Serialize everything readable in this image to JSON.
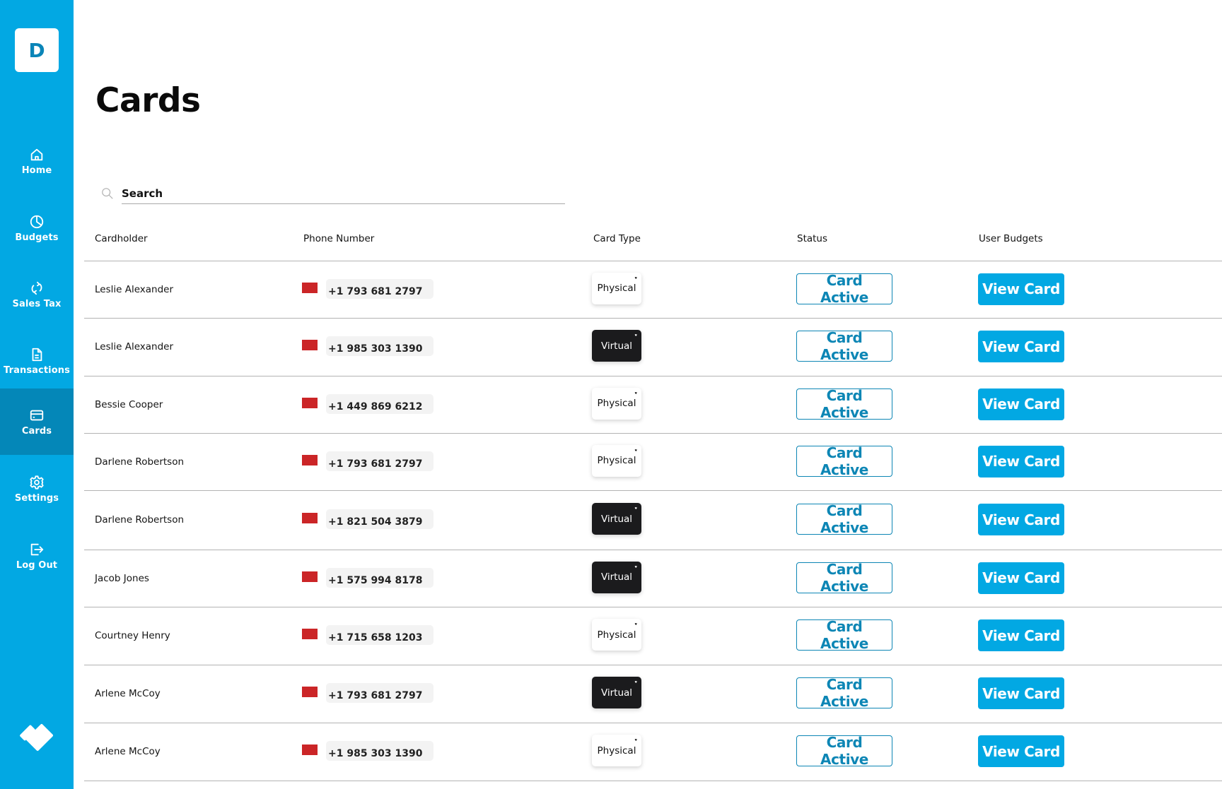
{
  "app": {
    "logo_letter": "D",
    "page_title": "Cards"
  },
  "sidebar": {
    "items": [
      {
        "label": "Home",
        "icon": "home-icon",
        "active": false
      },
      {
        "label": "Budgets",
        "icon": "pie-chart-icon",
        "active": false
      },
      {
        "label": "Sales Tax",
        "icon": "refresh-icon",
        "active": false
      },
      {
        "label": "Transactions",
        "icon": "document-icon",
        "active": false
      },
      {
        "label": "Cards",
        "icon": "credit-card-icon",
        "active": true
      },
      {
        "label": "Settings",
        "icon": "gear-icon",
        "active": false
      },
      {
        "label": "Log Out",
        "icon": "logout-icon",
        "active": false
      }
    ],
    "brand_icon": "brand-logo-icon"
  },
  "search": {
    "placeholder": "Search",
    "value": ""
  },
  "table": {
    "headers": [
      "Cardholder",
      "Phone Number",
      "Card Type",
      "Status",
      "User Budgets"
    ],
    "rows": [
      {
        "cardholder": "Leslie Alexander",
        "phone": "+1 793 681 2797",
        "card_type": "Physical",
        "status": "Card Active",
        "action": "View Card"
      },
      {
        "cardholder": "Leslie Alexander",
        "phone": "+1 985 303 1390",
        "card_type": "Virtual",
        "status": "Card Active",
        "action": "View Card"
      },
      {
        "cardholder": "Bessie Cooper",
        "phone": "+1 449 869 6212",
        "card_type": "Physical",
        "status": "Card Active",
        "action": "View Card"
      },
      {
        "cardholder": "Darlene Robertson",
        "phone": "+1 793 681 2797",
        "card_type": "Physical",
        "status": "Card Active",
        "action": "View Card"
      },
      {
        "cardholder": "Darlene Robertson",
        "phone": "+1 821 504 3879",
        "card_type": "Virtual",
        "status": "Card Active",
        "action": "View Card"
      },
      {
        "cardholder": "Jacob Jones",
        "phone": "+1 575 994 8178",
        "card_type": "Virtual",
        "status": "Card Active",
        "action": "View Card"
      },
      {
        "cardholder": "Courtney Henry",
        "phone": "+1 715 658 1203",
        "card_type": "Physical",
        "status": "Card Active",
        "action": "View Card"
      },
      {
        "cardholder": "Arlene McCoy",
        "phone": "+1 793 681 2797",
        "card_type": "Virtual",
        "status": "Card Active",
        "action": "View Card"
      },
      {
        "cardholder": "Arlene McCoy",
        "phone": "+1 985 303 1390",
        "card_type": "Physical",
        "status": "Card Active",
        "action": "View Card"
      }
    ]
  },
  "card_chip_logo": "♥",
  "colors": {
    "brand": "#02a8e3",
    "sidebar_active": "#0487b8",
    "status_outline": "#0d86b5",
    "flag": "#cb2527",
    "virtual_card": "#1b1b1d"
  }
}
